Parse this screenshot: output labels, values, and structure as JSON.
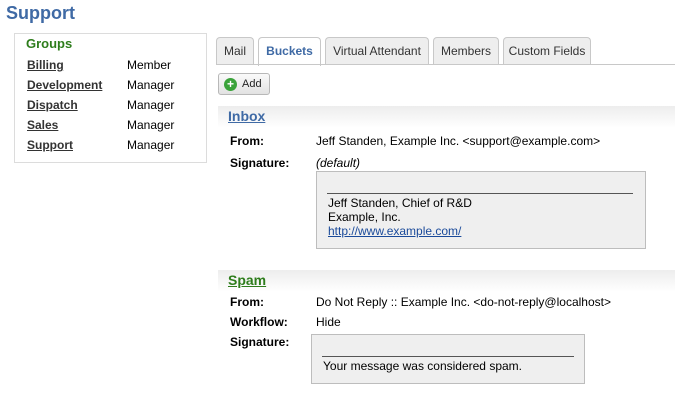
{
  "page": {
    "title": "Support"
  },
  "groups": {
    "title": "Groups",
    "items": [
      {
        "name": "Billing",
        "role": "Member"
      },
      {
        "name": "Development",
        "role": "Manager"
      },
      {
        "name": "Dispatch",
        "role": "Manager"
      },
      {
        "name": "Sales",
        "role": "Manager"
      },
      {
        "name": "Support",
        "role": "Manager"
      }
    ]
  },
  "tabs": [
    {
      "label": "Mail",
      "active": false
    },
    {
      "label": "Buckets",
      "active": true
    },
    {
      "label": "Virtual Attendant",
      "active": false
    },
    {
      "label": "Members",
      "active": false
    },
    {
      "label": "Custom Fields",
      "active": false
    }
  ],
  "toolbar": {
    "add_label": "Add",
    "add_icon": "plus-circle-icon"
  },
  "buckets": {
    "inbox": {
      "name": "Inbox",
      "name_color": "#3f6aa5",
      "from_label": "From:",
      "from_value": "Jeff Standen, Example Inc. <support@example.com>",
      "signature_label": "Signature:",
      "signature_note": "(default)",
      "signature_lines": [
        "Jeff Standen, Chief of R&D",
        "Example, Inc."
      ],
      "signature_link": "http://www.example.com/"
    },
    "spam": {
      "name": "Spam",
      "name_color": "#2e7d1c",
      "from_label": "From:",
      "from_value": "Do Not Reply :: Example Inc. <do-not-reply@localhost>",
      "workflow_label": "Workflow:",
      "workflow_value": "Hide",
      "signature_label": "Signature:",
      "signature_lines": [
        "Your message was considered spam."
      ]
    }
  }
}
